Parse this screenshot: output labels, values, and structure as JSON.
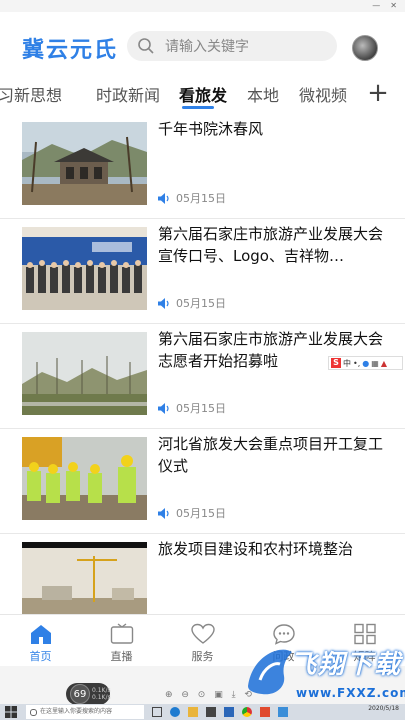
{
  "header": {
    "logo": "冀云元氏",
    "search_placeholder": "请输入关键字"
  },
  "tabs": [
    {
      "label": "习新思想"
    },
    {
      "label": "时政新闻"
    },
    {
      "label": "看旅发",
      "active": true
    },
    {
      "label": "本地"
    },
    {
      "label": "微视频"
    }
  ],
  "tab_add_symbol": "+",
  "news": [
    {
      "title": "千年书院沐春风",
      "date": "05月15日",
      "thumb": "courtyard"
    },
    {
      "title": "第六届石家庄市旅游产业发展大会宣传口号、Logo、吉祥物…",
      "date": "05月15日",
      "thumb": "meeting"
    },
    {
      "title": "第六届石家庄市旅游产业发展大会志愿者开始招募啦",
      "date": "05月15日",
      "thumb": "landscape"
    },
    {
      "title": "河北省旅发大会重点项目开工复工仪式",
      "date": "05月15日",
      "thumb": "workers"
    },
    {
      "title": "旅发项目建设和农村环境整治",
      "date": "",
      "thumb": "construction"
    }
  ],
  "bottom_nav": [
    {
      "label": "首页",
      "icon": "home-icon",
      "active": true
    },
    {
      "label": "直播",
      "icon": "tv-icon"
    },
    {
      "label": "服务",
      "icon": "heart-icon"
    },
    {
      "label": "问政",
      "icon": "chat-icon"
    },
    {
      "label": "矩阵",
      "icon": "grid-icon"
    }
  ],
  "emulator": {
    "perf_value": "69",
    "perf_unit": "%",
    "rate_up": "0.1K/s",
    "rate_down": "0.1K/s"
  },
  "watermark": {
    "text": "飞翔下载",
    "url": "www.FXXZ.com"
  },
  "taskbar": {
    "search_placeholder": "在这里输入你要搜索的内容",
    "date": "2020/5/18"
  },
  "colors": {
    "accent": "#2f80e6",
    "inactive": "#666666"
  }
}
